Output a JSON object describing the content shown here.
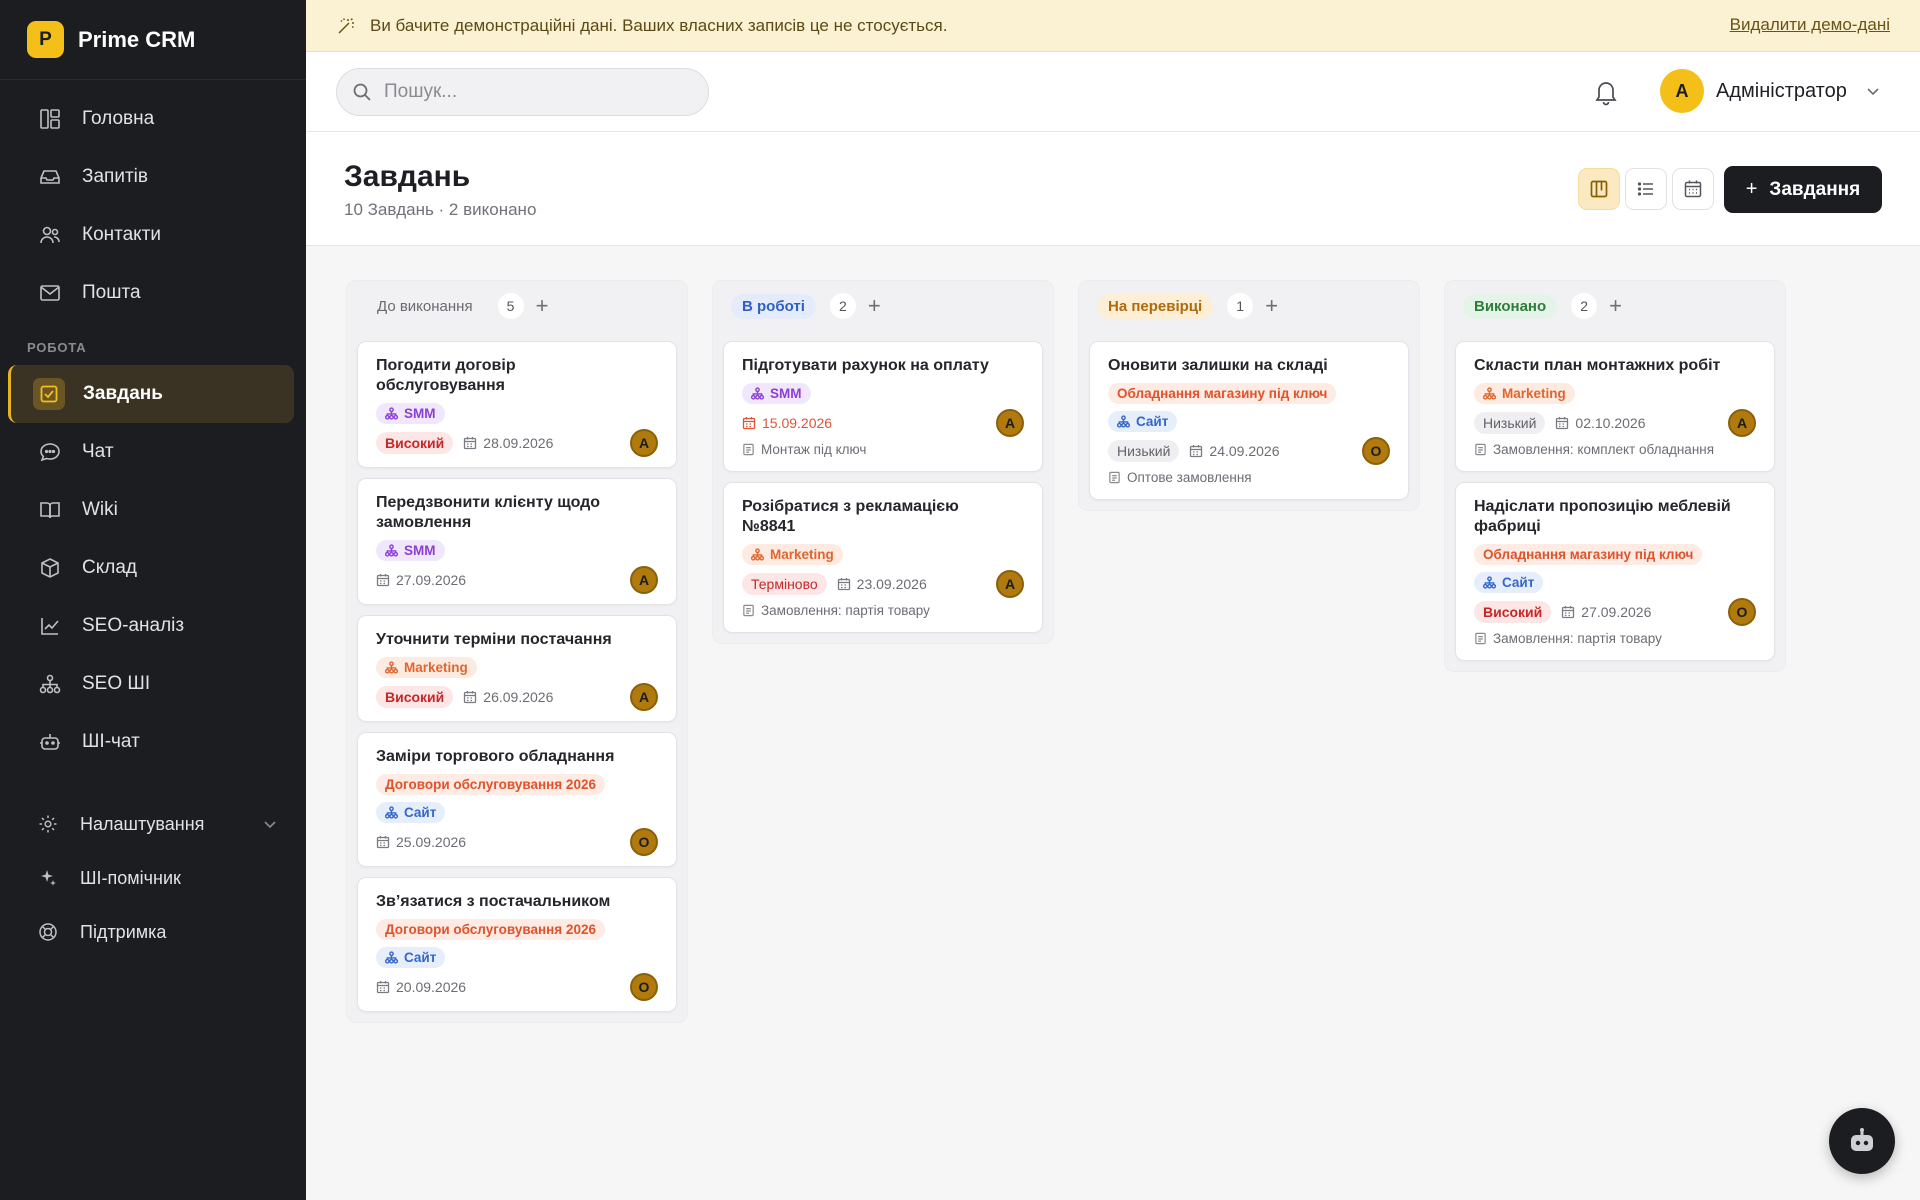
{
  "app": {
    "name": "Prime CRM",
    "logo_letter": "P"
  },
  "sidebar": {
    "main_items": [
      {
        "label": "Головна",
        "icon": "dashboard-icon"
      },
      {
        "label": "Запитів",
        "icon": "inbox-icon"
      },
      {
        "label": "Контакти",
        "icon": "users-icon"
      },
      {
        "label": "Пошта",
        "icon": "mail-icon"
      }
    ],
    "section_label": "РОБОТА",
    "work_items": [
      {
        "label": "Завдань",
        "icon": "task-check-icon",
        "active": true
      },
      {
        "label": "Чат",
        "icon": "chat-icon"
      },
      {
        "label": "Wiki",
        "icon": "book-icon"
      },
      {
        "label": "Склад",
        "icon": "box-icon"
      },
      {
        "label": "SEO-аналіз",
        "icon": "chart-line-icon"
      },
      {
        "label": "SEO ШІ",
        "icon": "sitemap-icon"
      },
      {
        "label": "ШІ-чат",
        "icon": "robot-icon"
      }
    ],
    "bottom_items": [
      {
        "label": "Налаштування",
        "icon": "gear-icon"
      },
      {
        "label": "ШІ-помічник",
        "icon": "sparkles-icon"
      },
      {
        "label": "Підтримка",
        "icon": "lifebuoy-icon"
      }
    ]
  },
  "banner": {
    "text": "Ви бачите демонстраційні дані. Ваших власних записів це не стосується.",
    "link": "Видалити демо-дані"
  },
  "topbar": {
    "search_placeholder": "Пошук...",
    "user_initial": "A",
    "user_name": "Адміністратор"
  },
  "header": {
    "title": "Завдань",
    "subtitle": "10 Завдань · 2 виконано",
    "add_button": "Завдання",
    "add_plus": "+"
  },
  "colors": {
    "accent": "#f5bf19",
    "sidebar_bg": "#1c1d21",
    "banner_bg": "#fbf1d3"
  },
  "board": {
    "columns": [
      {
        "title": "До виконання",
        "count": "5",
        "tag_bg": "transparent",
        "tag_color": "#6a6b72",
        "cards": [
          {
            "title": "Погодити договір обслуговування",
            "tags": [
              {
                "label": "SMM",
                "kind": "smm",
                "icon": true
              }
            ],
            "priority": "Високий",
            "priority_kind": "high",
            "date": "28.09.2026",
            "assignee": "A"
          },
          {
            "title": "Передзвонити клієнту щодо замовлення",
            "tags": [
              {
                "label": "SMM",
                "kind": "smm",
                "icon": true
              }
            ],
            "date": "27.09.2026",
            "assignee": "A"
          },
          {
            "title": "Уточнити терміни постачання",
            "tags": [
              {
                "label": "Marketing",
                "kind": "mkt",
                "icon": true
              }
            ],
            "priority": "Високий",
            "priority_kind": "high",
            "date": "26.09.2026",
            "assignee": "A"
          },
          {
            "title": "Заміри торгового обладнання",
            "tags": [
              {
                "label": "Договори обслуговування 2026",
                "kind": "orange",
                "icon": false
              },
              {
                "label": "Сайт",
                "kind": "site",
                "icon": true
              }
            ],
            "date": "25.09.2026",
            "assignee": "O"
          },
          {
            "title": "Зв’язатися з постачальником",
            "tags": [
              {
                "label": "Договори обслуговування 2026",
                "kind": "orange",
                "icon": false
              },
              {
                "label": "Сайт",
                "kind": "site",
                "icon": true
              }
            ],
            "date": "20.09.2026",
            "assignee": "O"
          }
        ]
      },
      {
        "title": "В роботі",
        "count": "2",
        "tag_bg": "#e4ecfb",
        "tag_color": "#2f5fc0",
        "cards": [
          {
            "title": "Підготувати рахунок на оплату",
            "tags": [
              {
                "label": "SMM",
                "kind": "smm",
                "icon": true
              }
            ],
            "date": "15.09.2026",
            "date_overdue": true,
            "assignee": "A",
            "project": "Монтаж під ключ"
          },
          {
            "title": "Розібратися з рекламацією №8841",
            "tags": [
              {
                "label": "Marketing",
                "kind": "mkt",
                "icon": true
              }
            ],
            "priority": "Терміново",
            "priority_kind": "urg",
            "date": "23.09.2026",
            "assignee": "A",
            "project": "Замовлення: партія товару"
          }
        ]
      },
      {
        "title": "На перевірці",
        "count": "1",
        "tag_bg": "#fcefd6",
        "tag_color": "#b06a0a",
        "cards": [
          {
            "title": "Оновити залишки на складі",
            "tags": [
              {
                "label": "Обладнання магазину під ключ",
                "kind": "orange",
                "icon": false
              },
              {
                "label": "Сайт",
                "kind": "site",
                "icon": true
              }
            ],
            "priority": "Низький",
            "priority_kind": "low",
            "date": "24.09.2026",
            "assignee": "O",
            "project": "Оптове замовлення"
          }
        ]
      },
      {
        "title": "Виконано",
        "count": "2",
        "tag_bg": "#e5f4e8",
        "tag_color": "#2e7d3a",
        "cards": [
          {
            "title": "Скласти план монтажних робіт",
            "tags": [
              {
                "label": "Marketing",
                "kind": "mkt",
                "icon": true
              }
            ],
            "priority": "Низький",
            "priority_kind": "low",
            "date": "02.10.2026",
            "assignee": "A",
            "project": "Замовлення: комплект обладнання"
          },
          {
            "title": "Надіслати пропозицію меблевій фабриці",
            "tags": [
              {
                "label": "Обладнання магазину під ключ",
                "kind": "orange",
                "icon": false
              },
              {
                "label": "Сайт",
                "kind": "site",
                "icon": true
              }
            ],
            "priority": "Високий",
            "priority_kind": "high",
            "date": "27.09.2026",
            "assignee": "O",
            "project": "Замовлення: партія товару"
          }
        ]
      }
    ]
  }
}
